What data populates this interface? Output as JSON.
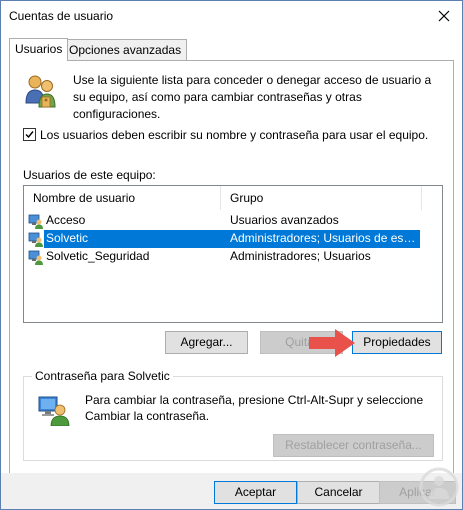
{
  "window": {
    "title": "Cuentas de usuario"
  },
  "tabs": [
    {
      "label": "Usuarios",
      "active": true
    },
    {
      "label": "Opciones avanzadas",
      "active": false
    }
  ],
  "intro": {
    "text": "Use la siguiente lista para conceder o denegar acceso de usuario a su equipo, así como para cambiar contraseñas y otras configuraciones."
  },
  "require_login": {
    "checked": true,
    "label": "Los usuarios deben escribir su nombre y contraseña para usar el equipo."
  },
  "user_list": {
    "label": "Usuarios de este equipo:",
    "columns": [
      "Nombre de usuario",
      "Grupo"
    ],
    "rows": [
      {
        "name": "Acceso",
        "group": "Usuarios avanzados",
        "selected": false
      },
      {
        "name": "Solvetic",
        "group": "Administradores; Usuarios de esc...",
        "selected": true
      },
      {
        "name": "Solvetic_Seguridad",
        "group": "Administradores; Usuarios",
        "selected": false
      }
    ]
  },
  "list_buttons": {
    "add": "Agregar...",
    "remove": "Quitar",
    "properties": "Propiedades"
  },
  "password_group": {
    "title": "Contraseña para Solvetic",
    "text": "Para cambiar la contraseña, presione Ctrl-Alt-Supr y seleccione Cambiar la contraseña.",
    "reset_button": "Restablecer contraseña..."
  },
  "dialog_buttons": {
    "ok": "Aceptar",
    "cancel": "Cancelar",
    "apply": "Aplicar"
  },
  "colors": {
    "selection": "#0078d7",
    "arrow": "#e8524a",
    "watermark": "#d9d9d9"
  },
  "icons": {
    "intro": "users-icon",
    "row_user": "user-account-icon",
    "password": "password-user-icon",
    "close": "close-icon",
    "annotation_arrow": "red-arrow-icon",
    "watermark": "solvetic-logo-icon"
  }
}
